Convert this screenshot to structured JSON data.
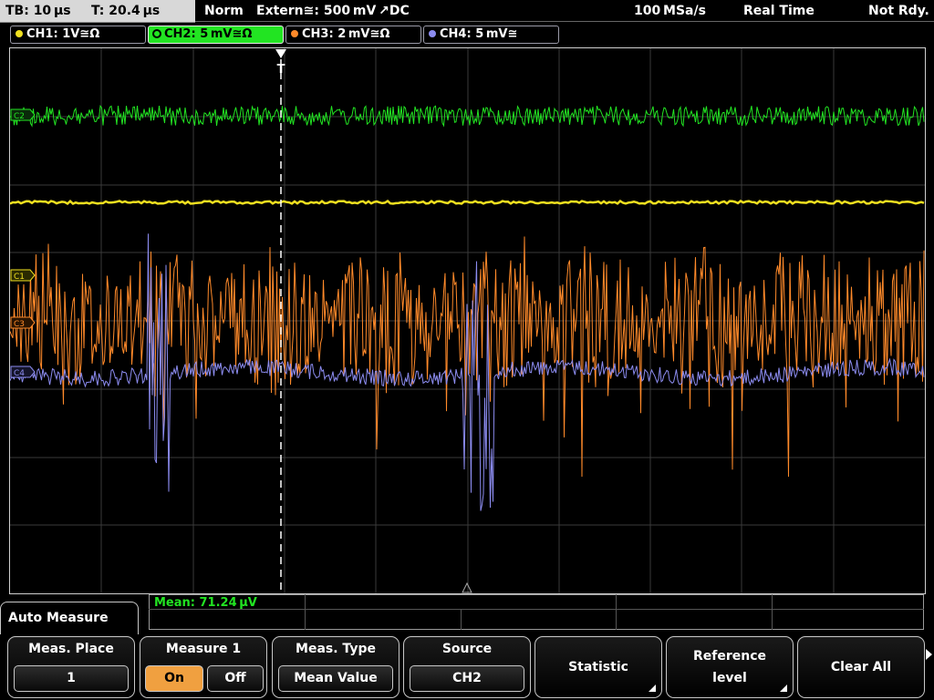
{
  "status_bar": {
    "timebase": "TB: 10 µs",
    "trigger_time": "T: 20.4 µs",
    "mode": "Norm",
    "trigger": "Extern≅: 500 mV ↗DC",
    "sample_rate": "100 MSa/s",
    "acq_mode": "Real Time",
    "state": "Not Rdy."
  },
  "channels": [
    {
      "label": "CH1: 1V≅Ω",
      "color": "#f0e020",
      "active": false
    },
    {
      "label": "CH2: 5 mV≅Ω",
      "color": "#22e422",
      "active": true
    },
    {
      "label": "CH3: 2 mV≅Ω",
      "color": "#ff8a2a",
      "active": false
    },
    {
      "label": "CH4: 5 mV≅",
      "color": "#8c8cf0",
      "active": false
    }
  ],
  "markers": {
    "c2": "C2",
    "c1": "C1",
    "c3": "C3",
    "c4": "C4",
    "trigger_t": "T"
  },
  "measurement": {
    "readout": "Mean: 71.24 µV"
  },
  "menu": {
    "title": "Auto Measure",
    "softkeys": {
      "meas_place": {
        "title": "Meas. Place",
        "value": "1"
      },
      "measure": {
        "title": "Measure 1",
        "on": "On",
        "off": "Off",
        "selected": "On"
      },
      "meas_type": {
        "title": "Meas. Type",
        "value": "Mean Value"
      },
      "source": {
        "title": "Source",
        "value": "CH2"
      },
      "statistic": {
        "label": "Statistic"
      },
      "reference": {
        "line1": "Reference",
        "line2": "level"
      },
      "clear": {
        "label": "Clear All"
      }
    }
  },
  "colors": {
    "ch1": "#f0e020",
    "ch2": "#22e422",
    "ch3": "#ff8a2a",
    "ch4": "#8c8cf0",
    "on_button": "#f0a040",
    "grid": "#3a3a3a"
  }
}
